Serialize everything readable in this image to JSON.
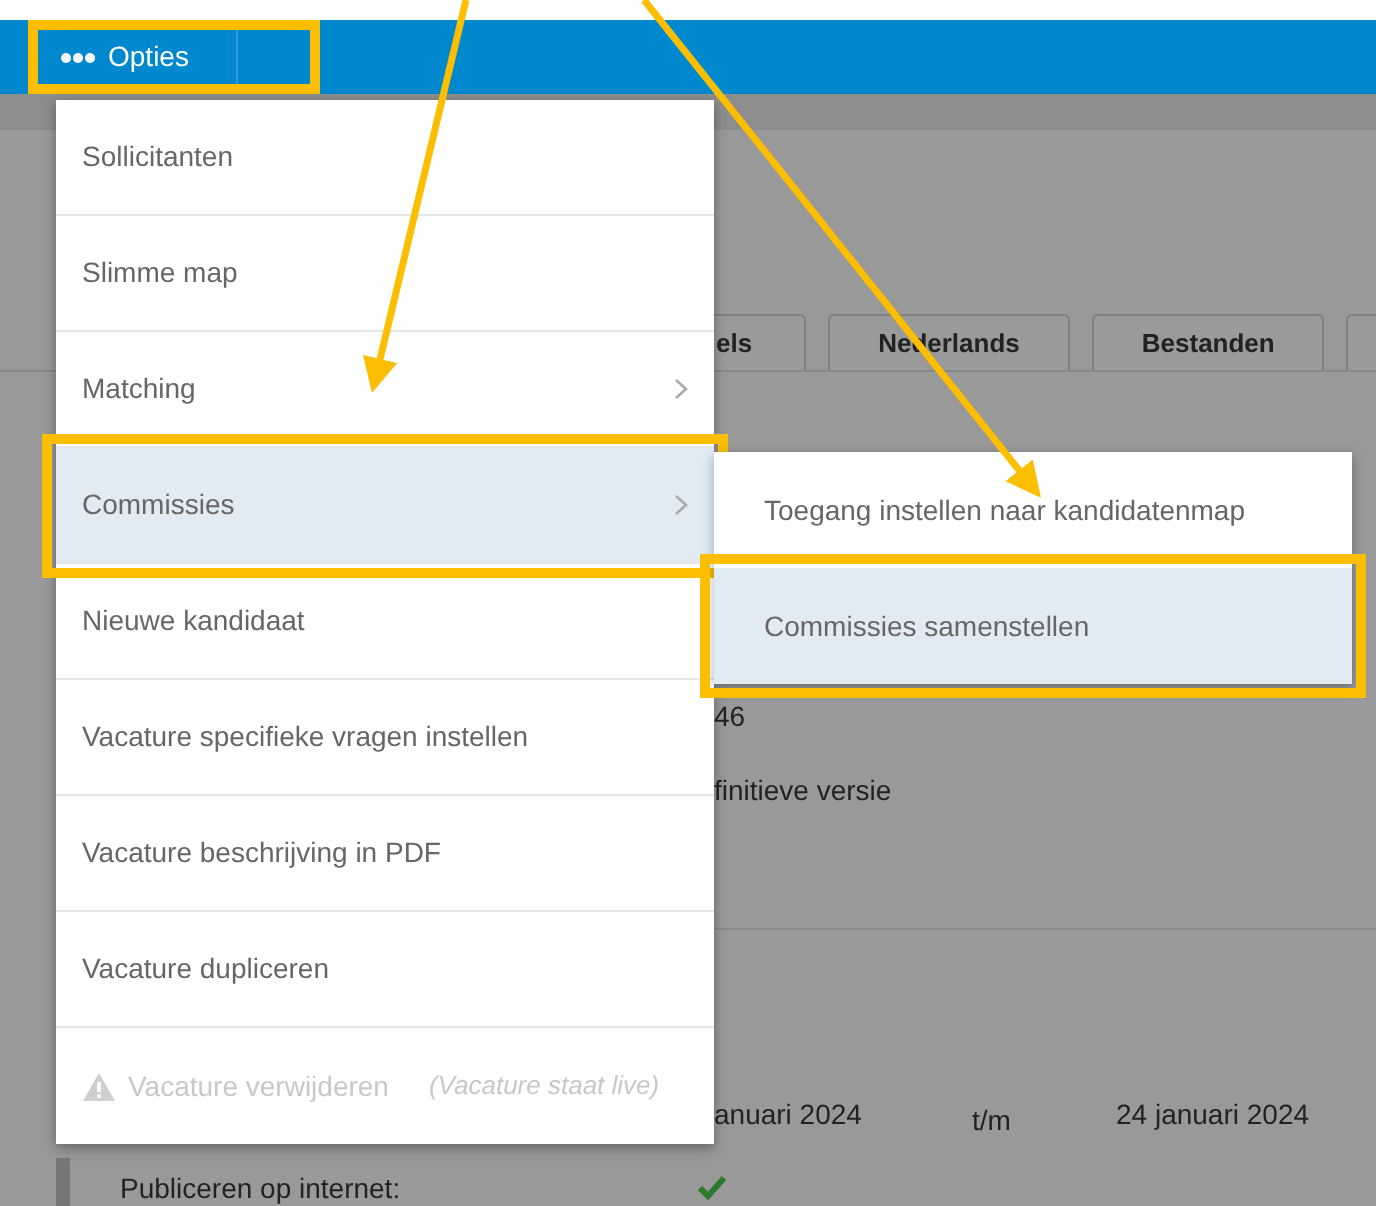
{
  "toolbar": {
    "button": {
      "label": "Opties",
      "highlighted": true
    }
  },
  "menu": {
    "items": [
      {
        "label": "Sollicitanten",
        "selected": false,
        "has_submenu": false,
        "disabled": false,
        "highlighted": false
      },
      {
        "label": "Slimme map",
        "selected": false,
        "has_submenu": false,
        "disabled": false,
        "highlighted": false
      },
      {
        "label": "Matching",
        "selected": false,
        "has_submenu": true,
        "disabled": false,
        "highlighted": false
      },
      {
        "label": "Commissies",
        "selected": true,
        "has_submenu": true,
        "disabled": false,
        "highlighted": true
      },
      {
        "label": "Nieuwe kandidaat",
        "selected": false,
        "has_submenu": false,
        "disabled": false,
        "highlighted": false
      },
      {
        "label": "Vacature specifieke vragen instellen",
        "selected": false,
        "has_submenu": false,
        "disabled": false,
        "highlighted": false
      },
      {
        "label": "Vacature beschrijving in PDF",
        "selected": false,
        "has_submenu": false,
        "disabled": false,
        "highlighted": false
      },
      {
        "label": "Vacature dupliceren",
        "selected": false,
        "has_submenu": false,
        "disabled": false,
        "highlighted": false
      },
      {
        "label": "Vacature verwijderen",
        "note": "(Vacature staat live)",
        "selected": false,
        "has_submenu": false,
        "disabled": true,
        "highlighted": false
      }
    ]
  },
  "submenu": {
    "items": [
      {
        "label": "Toegang instellen naar kandidatenmap",
        "selected": false,
        "highlighted": false
      },
      {
        "label": "Commissies samenstellen",
        "selected": true,
        "highlighted": true
      }
    ]
  },
  "background": {
    "tabs": [
      {
        "label": "els"
      },
      {
        "label": "Nederlands"
      },
      {
        "label": "Bestanden"
      }
    ],
    "lines": [
      "46",
      "finitieve versie"
    ],
    "period": {
      "from": "anuari 2024",
      "separator": "t/m",
      "to": "24 januari 2024"
    },
    "publish": {
      "label": "Publiceren op internet:",
      "checked": true
    }
  }
}
